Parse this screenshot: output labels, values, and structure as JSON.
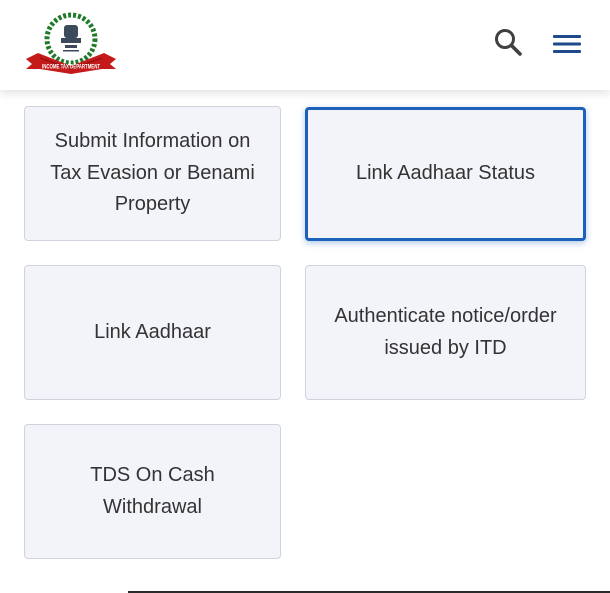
{
  "header": {
    "logo": {
      "alt": "Income Tax Department logo",
      "ribbon_text": "INCOME TAX DEPARTMENT",
      "colors": {
        "ribbon": "#c41a1a",
        "wreath": "#1f7a2a",
        "emblem": "#3d4a5c"
      }
    },
    "search_icon": "search-icon",
    "menu_icon": "hamburger-menu-icon"
  },
  "services": [
    {
      "label": "Submit Information on Tax Evasion or Benami Property",
      "selected": false
    },
    {
      "label": "Link Aadhaar Status",
      "selected": true
    },
    {
      "label": "Link Aadhaar",
      "selected": false
    },
    {
      "label": "Authenticate notice/order issued by ITD",
      "selected": false
    },
    {
      "label": "TDS On Cash Withdrawal",
      "selected": false
    }
  ],
  "colors": {
    "card_background": "#f3f4fa",
    "card_border": "#cfd3de",
    "selected_border": "#1c62b9",
    "text": "#333333",
    "menu_icon": "#1e4a8a"
  }
}
